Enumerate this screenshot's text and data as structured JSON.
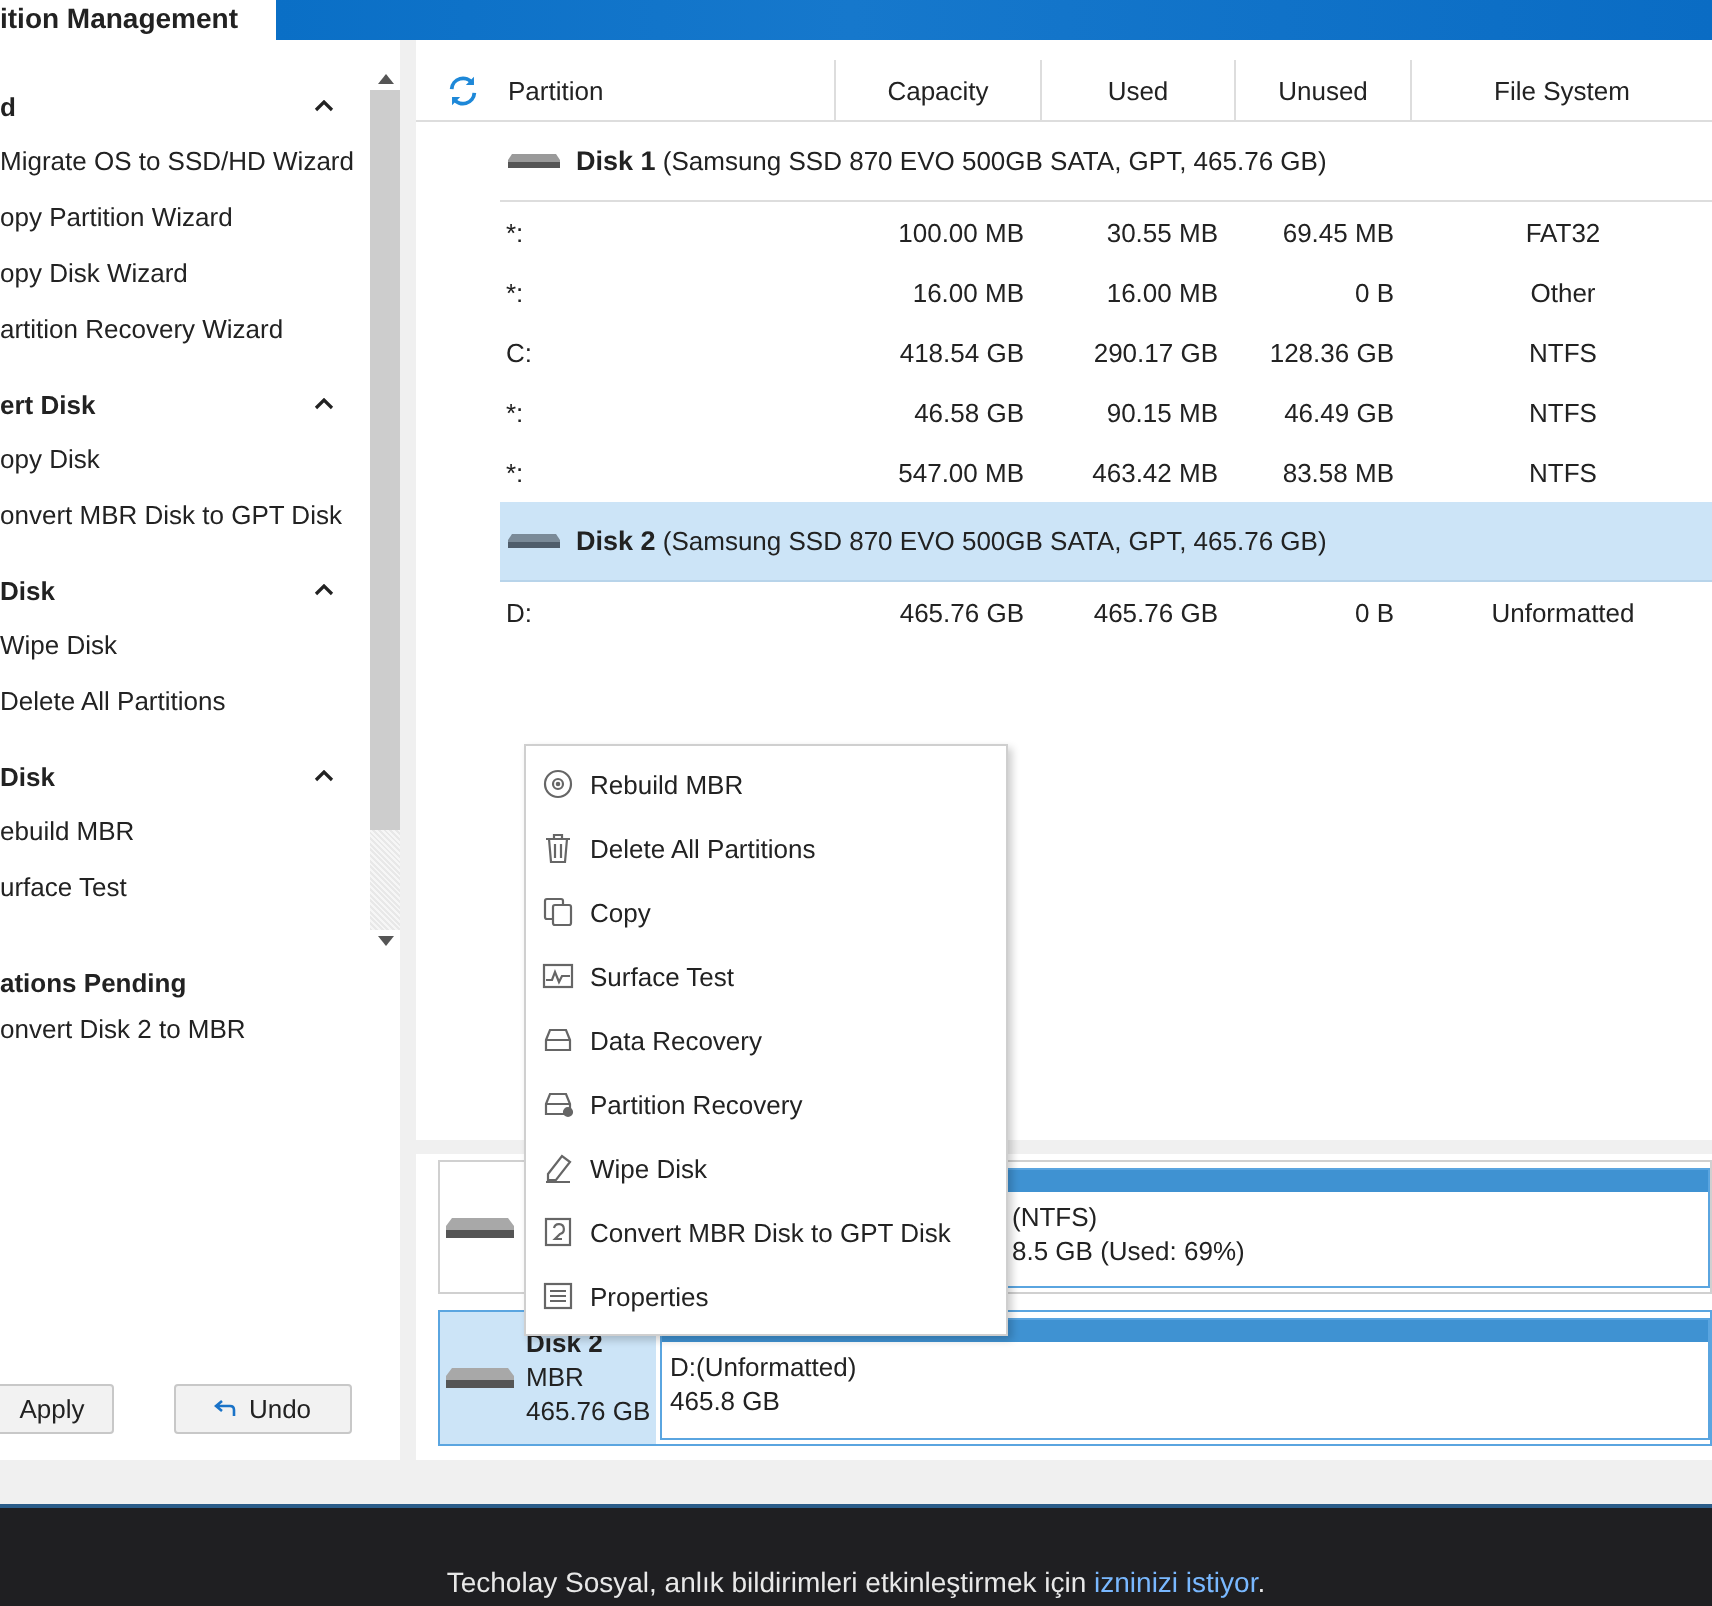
{
  "top_tab": "ition Management",
  "sidebar": {
    "sections": [
      {
        "title": "d",
        "expanded": true,
        "items": [
          "Migrate OS to SSD/HD Wizard",
          "opy Partition Wizard",
          "opy Disk Wizard",
          "artition Recovery Wizard"
        ]
      },
      {
        "title": "ert Disk",
        "expanded": true,
        "items": [
          "opy Disk",
          "onvert MBR Disk to GPT Disk"
        ]
      },
      {
        "title": "Disk",
        "expanded": true,
        "items": [
          "Wipe Disk",
          "Delete All Partitions"
        ]
      },
      {
        "title": "Disk",
        "expanded": true,
        "items": [
          "ebuild MBR",
          "urface Test"
        ]
      }
    ]
  },
  "pending": {
    "title": "ations Pending",
    "items": [
      "onvert Disk 2 to MBR"
    ]
  },
  "buttons": [
    {
      "label": "Apply",
      "kind": "apply"
    },
    {
      "label": "Undo",
      "kind": "undo"
    }
  ],
  "table": {
    "columns": [
      "Partition",
      "Capacity",
      "Used",
      "Unused",
      "File System"
    ],
    "disks": [
      {
        "name": "Disk 1",
        "detail": "(Samsung SSD 870 EVO 500GB SATA, GPT, 465.76 GB)",
        "selected": false,
        "partitions": [
          {
            "partition": "*:",
            "capacity": "100.00 MB",
            "used": "30.55 MB",
            "unused": "69.45 MB",
            "file_system": "FAT32"
          },
          {
            "partition": "*:",
            "capacity": "16.00 MB",
            "used": "16.00 MB",
            "unused": "0 B",
            "file_system": "Other"
          },
          {
            "partition": "C:",
            "capacity": "418.54 GB",
            "used": "290.17 GB",
            "unused": "128.36 GB",
            "file_system": "NTFS"
          },
          {
            "partition": "*:",
            "capacity": "46.58 GB",
            "used": "90.15 MB",
            "unused": "46.49 GB",
            "file_system": "NTFS"
          },
          {
            "partition": "*:",
            "capacity": "547.00 MB",
            "used": "463.42 MB",
            "unused": "83.58 MB",
            "file_system": "NTFS"
          }
        ]
      },
      {
        "name": "Disk 2",
        "detail": "(Samsung SSD 870 EVO 500GB SATA, GPT, 465.76 GB)",
        "selected": true,
        "partitions": [
          {
            "partition": "D:",
            "capacity": "465.76 GB",
            "used": "465.76 GB",
            "unused": "0 B",
            "file_system": "Unformatted"
          }
        ]
      }
    ]
  },
  "disk_map": [
    {
      "selected": false,
      "partition_label": "(NTFS)",
      "partition_size": "8.5 GB (Used: 69%)"
    },
    {
      "selected": true,
      "name": "Disk 2",
      "type": "MBR",
      "size": "465.76 GB",
      "partition_label": "D:(Unformatted)",
      "partition_size": "465.8 GB"
    }
  ],
  "context_menu": [
    "Rebuild MBR",
    "Delete All Partitions",
    "Copy",
    "Surface Test",
    "Data Recovery",
    "Partition Recovery",
    "Wipe Disk",
    "Convert MBR Disk to GPT Disk",
    "Properties"
  ],
  "notification": {
    "text": "Techolay Sosyal, anlık bildirimleri etkinleştirmek için ",
    "link": "izninizi istiyor",
    "after": "."
  }
}
